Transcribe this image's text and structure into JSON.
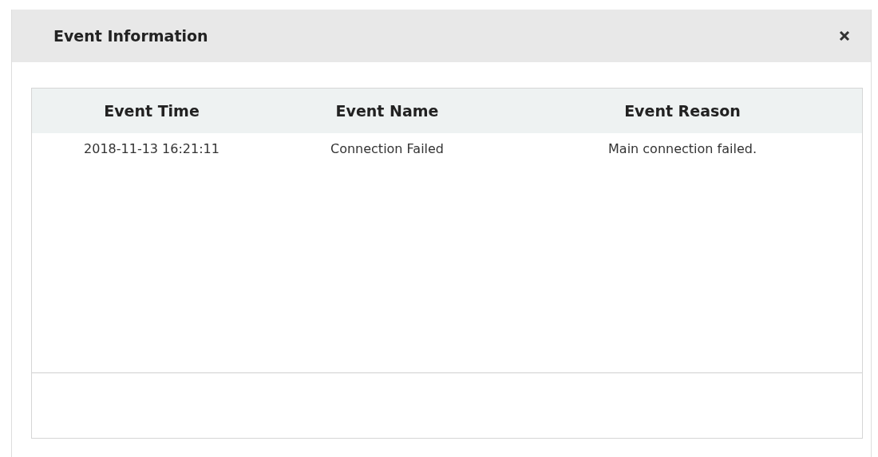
{
  "dialog": {
    "title": "Event Information"
  },
  "table": {
    "columns": [
      "Event Time",
      "Event Name",
      "Event Reason"
    ],
    "rows": [
      [
        "2018-11-13 16:21:11",
        "Connection Failed",
        "Main connection failed."
      ]
    ]
  }
}
